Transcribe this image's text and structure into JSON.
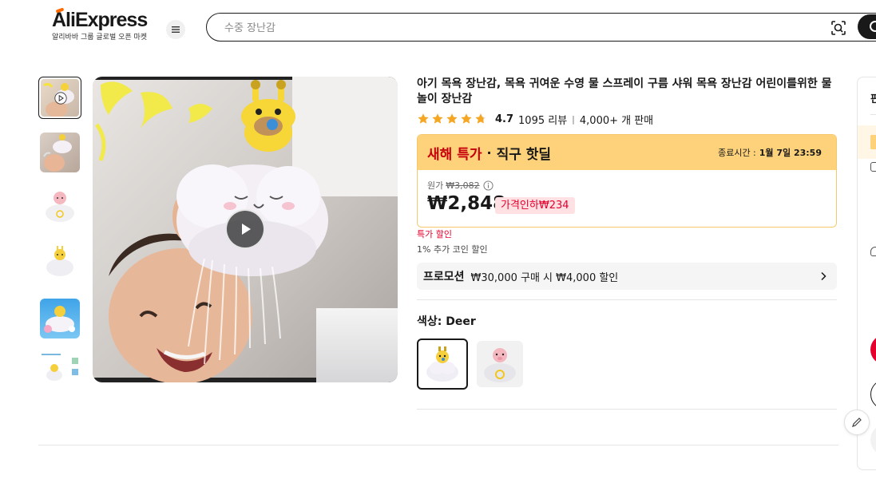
{
  "header": {
    "logo_text": "AliExpress",
    "logo_tagline": "알리바바 그룹 글로벌 오픈 마켓",
    "search_placeholder": "수중 장난감"
  },
  "product": {
    "title": "아기 목욕 장난감, 목욕 귀여운 수영 물 스프레이 구름 샤워 목욕 장난감 어린이를위한 물 놀이 장난감",
    "rating": "4.7",
    "rating_stars": 4.7,
    "reviews": "1095 리뷰",
    "sold": "4,000+ 개 판매"
  },
  "deal": {
    "title_highlight": "새해 특가",
    "title_dot": "·",
    "title_rest": "직구 핫딜",
    "end_label": "종료시간 :",
    "end_time": "1월 7일 23:59",
    "original_label": "원가",
    "original_price": "₩3,082",
    "price": "₩2,848",
    "discount": "가격인하₩234"
  },
  "sale_label": "특가 할인",
  "coin_label": "1% 추가 코인 할인",
  "promotion": {
    "tag": "프로모션",
    "text": "₩30,000 구매 시 ₩4,000 할인"
  },
  "variants": {
    "label": "색상: Deer",
    "options": [
      "Deer",
      "Pig"
    ],
    "selected": "Deer"
  },
  "right_panel": {
    "title": "판"
  },
  "colors": {
    "accent_red": "#e5002d",
    "deal_yellow": "#fdd27a",
    "deal_red": "#c7000b",
    "star": "#f5a623"
  }
}
